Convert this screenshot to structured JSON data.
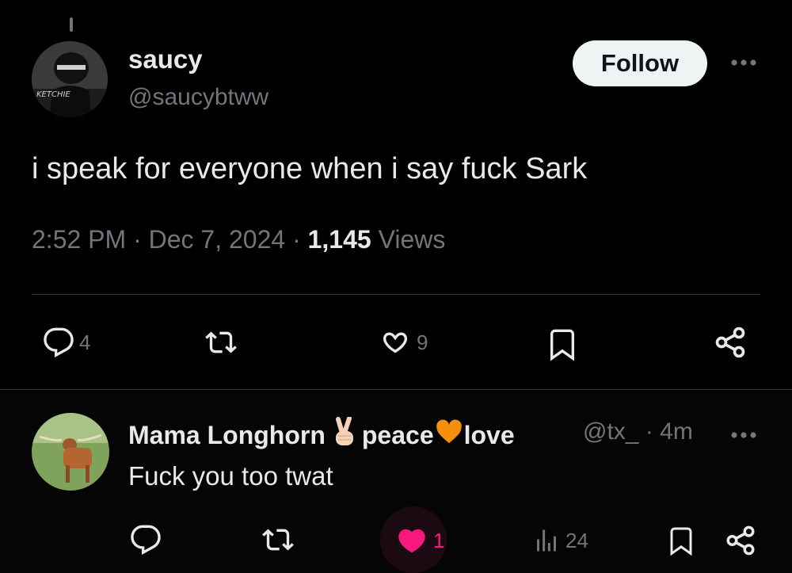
{
  "tweet": {
    "author_name": "saucy",
    "author_handle": "@saucybtww",
    "follow_label": "Follow",
    "text": "i speak for everyone when i say fuck Sark",
    "time": "2:52 PM",
    "separator": " · ",
    "date": "Dec 7, 2024",
    "views_count": "1,145",
    "views_label": "Views",
    "actions": {
      "reply_count": "4",
      "like_count": "9"
    },
    "avatar_text": "KETCHIE"
  },
  "reply": {
    "author_name_1": "Mama Longhorn",
    "author_name_2": "peace",
    "author_name_3": "love",
    "author_handle": "@tx_",
    "time": "· 4m",
    "text": "Fuck you too twat",
    "actions": {
      "like_count": "1",
      "views_count": "24"
    }
  },
  "colors": {
    "background": "#000000",
    "text_primary": "#e7e9ea",
    "text_secondary": "#71767b",
    "divider": "#2f3336",
    "like_pink": "#f91880",
    "heart_orange": "#f4900c"
  }
}
